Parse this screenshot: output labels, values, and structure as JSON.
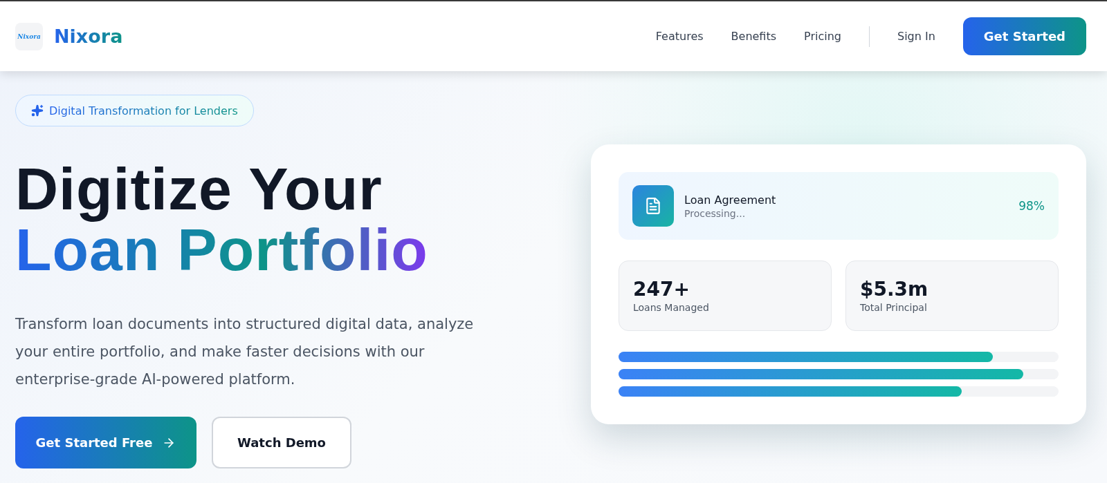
{
  "header": {
    "logo_mark": "Nixora",
    "brand": "Nixora",
    "nav": [
      "Features",
      "Benefits",
      "Pricing"
    ],
    "sign_in": "Sign In",
    "cta": "Get Started"
  },
  "hero": {
    "badge": "Digital Transformation for Lenders",
    "title_line1": "Digitize Your",
    "title_line2": "Loan Portfolio",
    "description": "Transform loan documents into structured digital data, analyze your entire portfolio, and make faster decisions with our enterprise-grade AI-powered platform.",
    "primary_button": "Get Started Free",
    "secondary_button": "Watch Demo"
  },
  "card": {
    "document": {
      "title": "Loan Agreement",
      "status": "Processing...",
      "percent": "98%"
    },
    "stats": [
      {
        "value": "247+",
        "label": "Loans Managed"
      },
      {
        "value": "$5.3m",
        "label": "Total Principal"
      }
    ],
    "bars": [
      {
        "level": 0.85
      },
      {
        "level": 0.92
      },
      {
        "level": 0.78
      }
    ]
  }
}
